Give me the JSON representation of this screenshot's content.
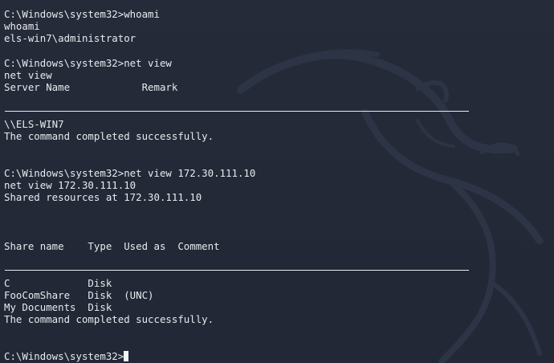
{
  "terminal": {
    "prompt": "C:\\Windows\\system32>",
    "cmd_whoami": "whoami",
    "echo_whoami": "whoami",
    "user": "els-win7\\administrator",
    "cmd_netview": "net view",
    "echo_netview": "net view",
    "netview_header": "Server Name            Remark",
    "server": "\\\\ELS-WIN7",
    "success_1": "The command completed successfully.",
    "cmd_netview_ip": "net view 172.30.111.10",
    "echo_netview_ip": "net view 172.30.111.10",
    "shared_at": "Shared resources at 172.30.111.10",
    "shares_header": "Share name    Type  Used as  Comment",
    "shares": [
      {
        "text": "C             Disk"
      },
      {
        "text": "FooComShare   Disk  (UNC)"
      },
      {
        "text": "My Documents  Disk"
      }
    ],
    "success_2": "The command completed successfully.",
    "final_prompt": "C:\\Windows\\system32>"
  },
  "colors": {
    "background": "#222836",
    "text": "#e8eaee",
    "watermark": "#2c3343"
  },
  "icons": {
    "watermark": "kali-dragon-icon"
  }
}
